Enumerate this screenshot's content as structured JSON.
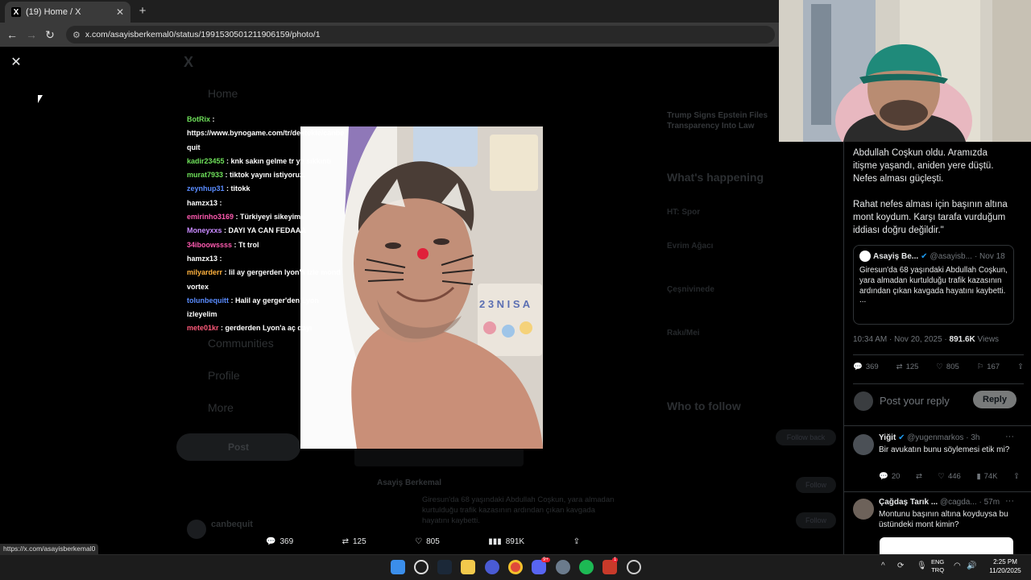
{
  "browser": {
    "tab_title": "(19) Home / X",
    "url": "x.com/asayisberkemal0/status/1991530501211906159/photo/1",
    "status_url": "https://x.com/asayisberkemal0"
  },
  "chat": [
    {
      "user": "BotRix",
      "color": "#6ee05a",
      "msg": ": https://www.bynogame.com/tr/destekle/canbe quit"
    },
    {
      "user": "kadir23455",
      "color": "#6ee05a",
      "msg": ": knk sakın gelme tr ye sıkkıntı"
    },
    {
      "user": "murat7933",
      "color": "#6ee05a",
      "msg": ": tiktok yayını istiyoruz."
    },
    {
      "user": "zeynhup31",
      "color": "#5a8cff",
      "msg": ": titokk"
    },
    {
      "user": "hamzx13",
      "color": "#ffffff",
      "msg": ":"
    },
    {
      "user": "emirinho3169",
      "color": "#ff5ab0",
      "msg": ": Türkiyeyi sikeyim"
    },
    {
      "user": "Moneyxxs",
      "color": "#c98bff",
      "msg": ": DAYI YA CAN FEDAAA"
    },
    {
      "user": "34iboowssss",
      "color": "#ff5ab0",
      "msg": ": Tt trol"
    },
    {
      "user": "hamzx13",
      "color": "#ffffff",
      "msg": ":"
    },
    {
      "user": "milyarderr",
      "color": "#ffb23e",
      "msg": ": lil ay gergerden lyon'a izle mond vortex"
    },
    {
      "user": "tolunbequitt",
      "color": "#5a8cff",
      "msg": ": Halil ay gerger'den Lyon izleyelim"
    },
    {
      "user": "mete01kr",
      "color": "#ff5a7a",
      "msg": ": gerderden Lyon'a aç dayı"
    }
  ],
  "photo_actions": {
    "replies": "369",
    "reposts": "125",
    "likes": "805",
    "views": "891K"
  },
  "background": {
    "nav": [
      "Home",
      "Communities",
      "Profile",
      "More"
    ],
    "post_btn": "Post",
    "trend_title": "Trump Signs Epstein Files Transparency Into Law",
    "whats_happening": "What's happening",
    "who_to_follow": "Who to follow",
    "follow_back": "Follow back",
    "follow": "Follow",
    "footer_name": "canbequit",
    "feed_author": "Asayiş Berkemal",
    "feed_text": "Giresun'da 68 yaşındaki Abdullah Coşkun, yara almadan kurtulduğu trafik kazasının ardından çıkan kavgada hayatını kaybetti.",
    "trend_items": [
      "HT: Spor",
      "Evrim Ağacı",
      "Çeşnivinede",
      "Rakı/Mei"
    ]
  },
  "thread": {
    "para1": "Abdullah Coşkun oldu. Aramızda itişme yaşandı, aniden yere düştü. Nefes alması güçleşti.",
    "para2": "Rahat nefes alması için başının altına mont koydum. Karşı tarafa vurduğum iddiası doğru değildir.\"",
    "quote": {
      "name": "Asayiş Be...",
      "handle": "@asayisb...",
      "date": "· Nov 18",
      "text": "Giresun'da 68 yaşındaki Abdullah Coşkun, yara almadan kurtulduğu trafik kazasının ardından çıkan kavgada hayatını kaybetti.",
      "more": "..."
    },
    "timestamp": "10:34 AM · Nov 20, 2025 ·",
    "views_count": "891.6K",
    "views_label": "Views",
    "stats": {
      "replies": "369",
      "reposts": "125",
      "likes": "805",
      "bookmarks": "167"
    },
    "reply_placeholder": "Post your reply",
    "reply_button": "Reply",
    "replies": [
      {
        "name": "Yiğit",
        "handle": "@yugenmarkos · 3h",
        "text": "Bir avukatın bunu söylemesi etik mi?",
        "replies": "20",
        "likes": "446",
        "views": "74K"
      },
      {
        "name": "Çağdaş Tarık ...",
        "handle": "@cagda... · 57m",
        "text": "Montunu başının altına koyduysa bu üstündeki mont kimin?"
      }
    ]
  },
  "taskbar": {
    "lang_top": "ENG",
    "lang_bottom": "TRQ",
    "time": "2:25 PM",
    "date": "11/20/2025",
    "discord_badge": "9+",
    "app_badge": "1"
  }
}
